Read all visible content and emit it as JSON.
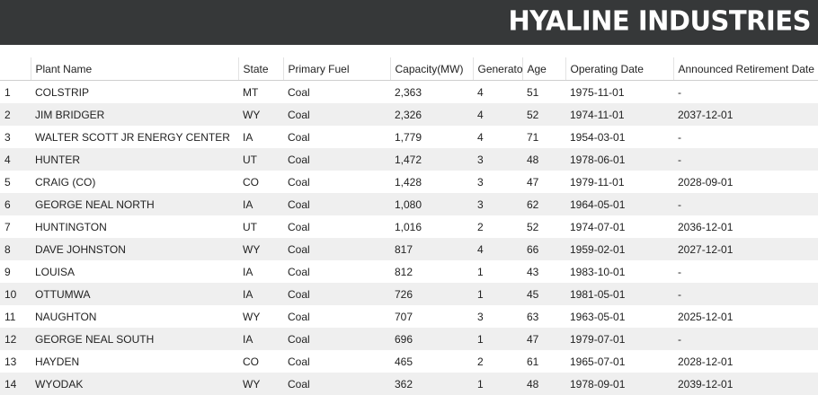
{
  "header": {
    "brand": "HYALINE INDUSTRIES"
  },
  "table": {
    "columns": [
      "",
      "Plant Name",
      "State",
      "Primary Fuel",
      "Capacity(MW)",
      "Generators",
      "Age",
      "Operating Date",
      "Announced Retirement Date"
    ],
    "rows": [
      [
        "1",
        "COLSTRIP",
        "MT",
        "Coal",
        "2,363",
        "4",
        "51",
        "1975-11-01",
        "-"
      ],
      [
        "2",
        "JIM BRIDGER",
        "WY",
        "Coal",
        "2,326",
        "4",
        "52",
        "1974-11-01",
        "2037-12-01"
      ],
      [
        "3",
        "WALTER SCOTT JR ENERGY CENTER",
        "IA",
        "Coal",
        "1,779",
        "4",
        "71",
        "1954-03-01",
        "-"
      ],
      [
        "4",
        "HUNTER",
        "UT",
        "Coal",
        "1,472",
        "3",
        "48",
        "1978-06-01",
        "-"
      ],
      [
        "5",
        "CRAIG (CO)",
        "CO",
        "Coal",
        "1,428",
        "3",
        "47",
        "1979-11-01",
        "2028-09-01"
      ],
      [
        "6",
        "GEORGE NEAL NORTH",
        "IA",
        "Coal",
        "1,080",
        "3",
        "62",
        "1964-05-01",
        "-"
      ],
      [
        "7",
        "HUNTINGTON",
        "UT",
        "Coal",
        "1,016",
        "2",
        "52",
        "1974-07-01",
        "2036-12-01"
      ],
      [
        "8",
        "DAVE JOHNSTON",
        "WY",
        "Coal",
        "817",
        "4",
        "66",
        "1959-02-01",
        "2027-12-01"
      ],
      [
        "9",
        "LOUISA",
        "IA",
        "Coal",
        "812",
        "1",
        "43",
        "1983-10-01",
        "-"
      ],
      [
        "10",
        "OTTUMWA",
        "IA",
        "Coal",
        "726",
        "1",
        "45",
        "1981-05-01",
        "-"
      ],
      [
        "11",
        "NAUGHTON",
        "WY",
        "Coal",
        "707",
        "3",
        "63",
        "1963-05-01",
        "2025-12-01"
      ],
      [
        "12",
        "GEORGE NEAL SOUTH",
        "IA",
        "Coal",
        "696",
        "1",
        "47",
        "1979-07-01",
        "-"
      ],
      [
        "13",
        "HAYDEN",
        "CO",
        "Coal",
        "465",
        "2",
        "61",
        "1965-07-01",
        "2028-12-01"
      ],
      [
        "14",
        "WYODAK",
        "WY",
        "Coal",
        "362",
        "1",
        "48",
        "1978-09-01",
        "2039-12-01"
      ]
    ]
  }
}
